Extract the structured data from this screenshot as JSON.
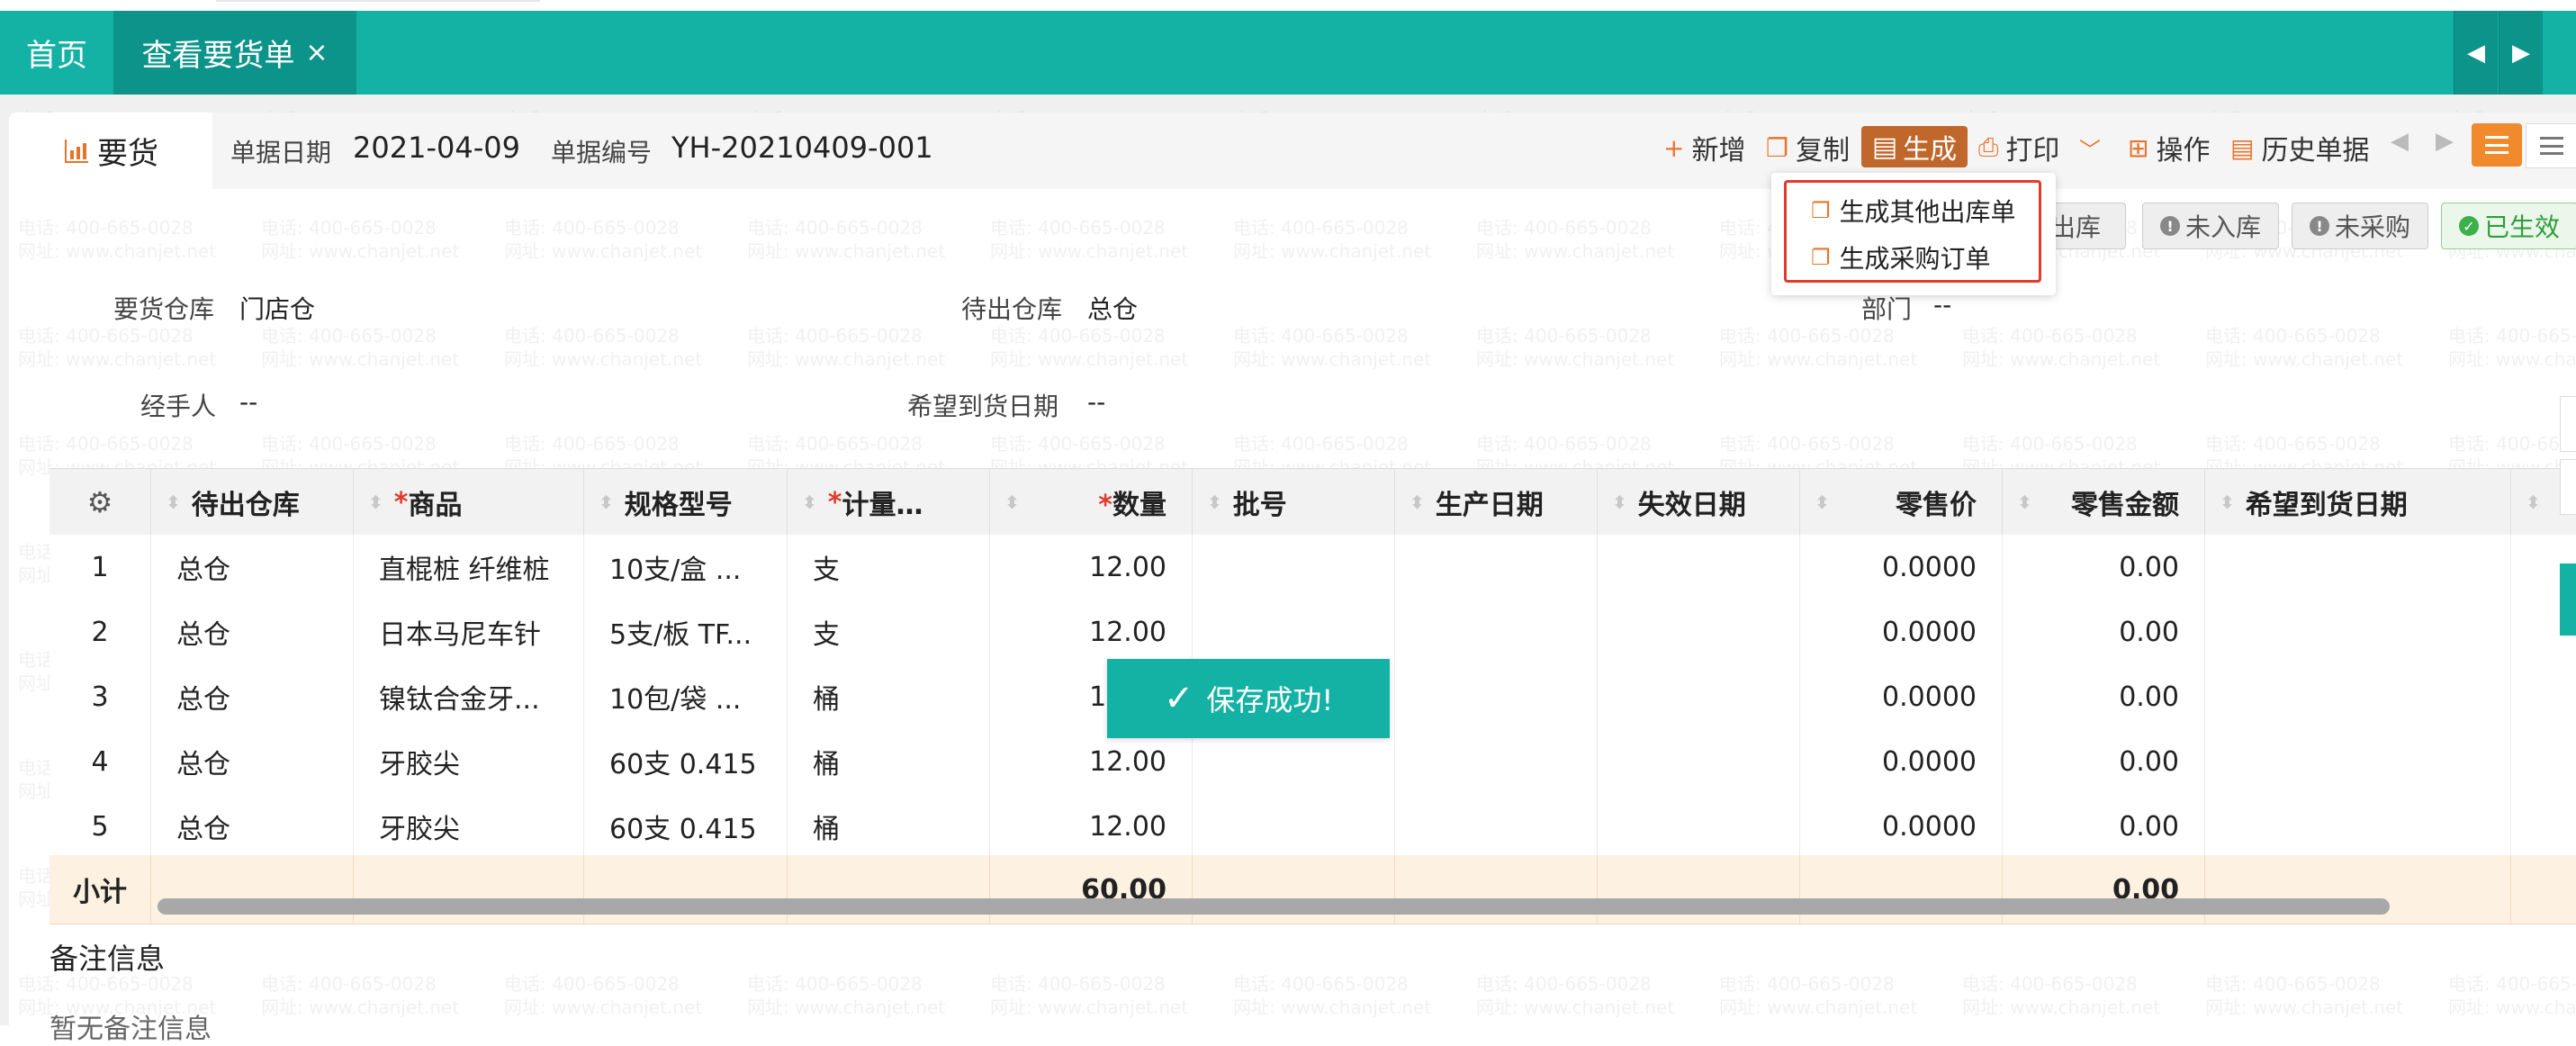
{
  "tabs": {
    "home": "首页",
    "active": "查看要货单",
    "close": "×"
  },
  "doc": {
    "tab_label": "要货",
    "date_label": "单据日期",
    "date_value": "2021-04-09",
    "number_label": "单据编号",
    "number_value": "YH-20210409-001"
  },
  "toolbar": {
    "new": "新增",
    "copy": "复制",
    "generate": "生成",
    "print": "打印",
    "operate": "操作",
    "history": "历史单据"
  },
  "dropdown": {
    "items": [
      "生成其他出库单",
      "生成采购订单"
    ]
  },
  "badges": {
    "outbound": "未出库",
    "outbound_visible": "出库",
    "inbound": "未入库",
    "purchase": "未采购",
    "effective": "已生效"
  },
  "form": {
    "request_wh_label": "要货仓库",
    "request_wh_value": "门店仓",
    "out_wh_label": "待出仓库",
    "out_wh_value": "总仓",
    "dept_label": "部门",
    "dept_value": "--",
    "handler_label": "经手人",
    "handler_value": "--",
    "expected_date_label": "希望到货日期",
    "expected_date_value": "--"
  },
  "grid": {
    "headers": {
      "out_wh": "待出仓库",
      "product": "商品",
      "spec": "规格型号",
      "unit": "计量…",
      "qty": "数量",
      "batch": "批号",
      "prod_date": "生产日期",
      "exp_date": "失效日期",
      "price": "零售价",
      "amount": "零售金额",
      "expected": "希望到货日期"
    },
    "rows": [
      {
        "no": "1",
        "wh": "总仓",
        "product": "直棍桩 纤维桩",
        "spec": "10支/盒 ...",
        "unit": "支",
        "qty": "12.00",
        "price": "0.0000",
        "amount": "0.00"
      },
      {
        "no": "2",
        "wh": "总仓",
        "product": "日本马尼车针",
        "spec": "5支/板 TF...",
        "unit": "支",
        "qty": "12.00",
        "price": "0.0000",
        "amount": "0.00"
      },
      {
        "no": "3",
        "wh": "总仓",
        "product": "镍钛合金牙...",
        "spec": "10包/袋 ...",
        "unit": "桶",
        "qty": "12.00",
        "price": "0.0000",
        "amount": "0.00"
      },
      {
        "no": "4",
        "wh": "总仓",
        "product": "牙胶尖",
        "spec": "60支 0.415",
        "unit": "桶",
        "qty": "12.00",
        "price": "0.0000",
        "amount": "0.00"
      },
      {
        "no": "5",
        "wh": "总仓",
        "product": "牙胶尖",
        "spec": "60支 0.415",
        "unit": "桶",
        "qty": "12.00",
        "price": "0.0000",
        "amount": "0.00"
      }
    ],
    "subtotal_label": "小计",
    "subtotal_qty": "60.00",
    "subtotal_amount": "0.00"
  },
  "toast": "保存成功!",
  "remarks": {
    "title": "备注信息",
    "empty": "暂无备注信息"
  },
  "watermark": {
    "phone": "电话: 400-665-0028",
    "site": "网址: www.chanjet.net"
  },
  "colors": {
    "teal": "#14b1a5",
    "teal_dark": "#0c948a",
    "accent": "#e8742b",
    "generate_btn": "#c0672b",
    "highlight": "#e03b2e",
    "subtotal_bg": "#fdf1e2"
  }
}
